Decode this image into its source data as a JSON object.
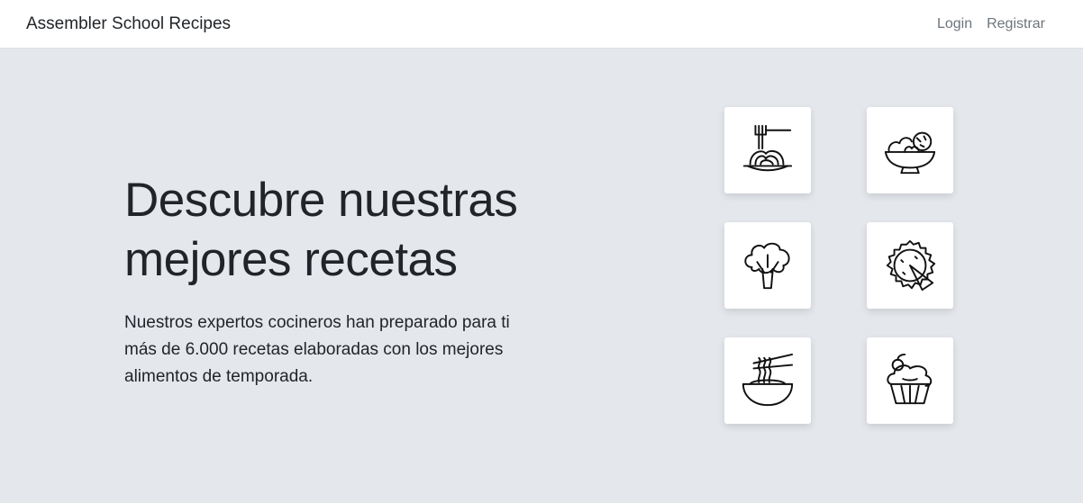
{
  "navbar": {
    "brand": "Assembler School Recipes",
    "links": [
      {
        "label": "Login"
      },
      {
        "label": "Registrar"
      }
    ]
  },
  "hero": {
    "title_line1": "Descubre nuestras",
    "title_line2": "mejores recetas",
    "subtitle": "Nuestros expertos cocineros han preparado para ti más de 6.000 recetas elaboradas con los mejores alimentos de temporada."
  },
  "categories": [
    {
      "icon": "spaghetti-icon"
    },
    {
      "icon": "salad-bowl-icon"
    },
    {
      "icon": "broccoli-icon"
    },
    {
      "icon": "pie-icon"
    },
    {
      "icon": "noodle-bowl-icon"
    },
    {
      "icon": "cupcake-icon"
    }
  ],
  "colors": {
    "background": "#e4e7ec",
    "navbar": "#ffffff",
    "link": "#6c757d",
    "text": "#212529"
  }
}
